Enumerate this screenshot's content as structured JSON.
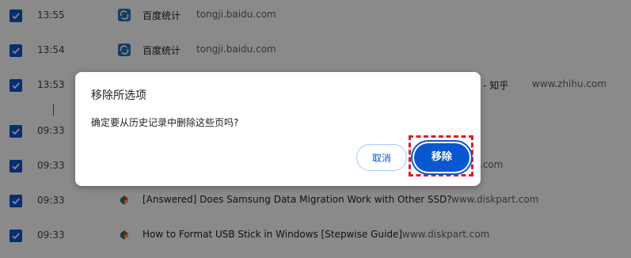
{
  "history": {
    "rows": [
      {
        "time": "13:55",
        "title": "百度统计",
        "domain": "tongji.baidu.com",
        "icon": "baidu-tongji-icon"
      },
      {
        "time": "13:54",
        "title": "百度统计",
        "domain": "tongji.baidu.com",
        "icon": "baidu-tongji-icon"
      },
      {
        "time": "13:53",
        "title": "? - 知乎",
        "domain": "www.zhihu.com",
        "icon": "zhihu-icon"
      },
      {
        "time": "09:33",
        "title": "",
        "domain": "",
        "icon": ""
      },
      {
        "time": "09:33",
        "title": "",
        "domain": ".com",
        "icon": ""
      },
      {
        "time": "09:33",
        "title": "[Answered] Does Samsung Data Migration Work with Other SSD?",
        "domain": "www.diskpart.com",
        "icon": "diskpart-icon"
      },
      {
        "time": "09:33",
        "title": "How to Format USB Stick in Windows [Stepwise Guide]",
        "domain": "www.diskpart.com",
        "icon": "diskpart-icon"
      }
    ]
  },
  "dialog": {
    "title": "移除所选项",
    "message": "确定要从历史记录中删除这些页吗?",
    "cancel_label": "取消",
    "remove_label": "移除"
  },
  "colors": {
    "accent": "#0b57d0",
    "highlight": "#e21b23",
    "overlay": "rgba(0,0,0,0.46)"
  }
}
